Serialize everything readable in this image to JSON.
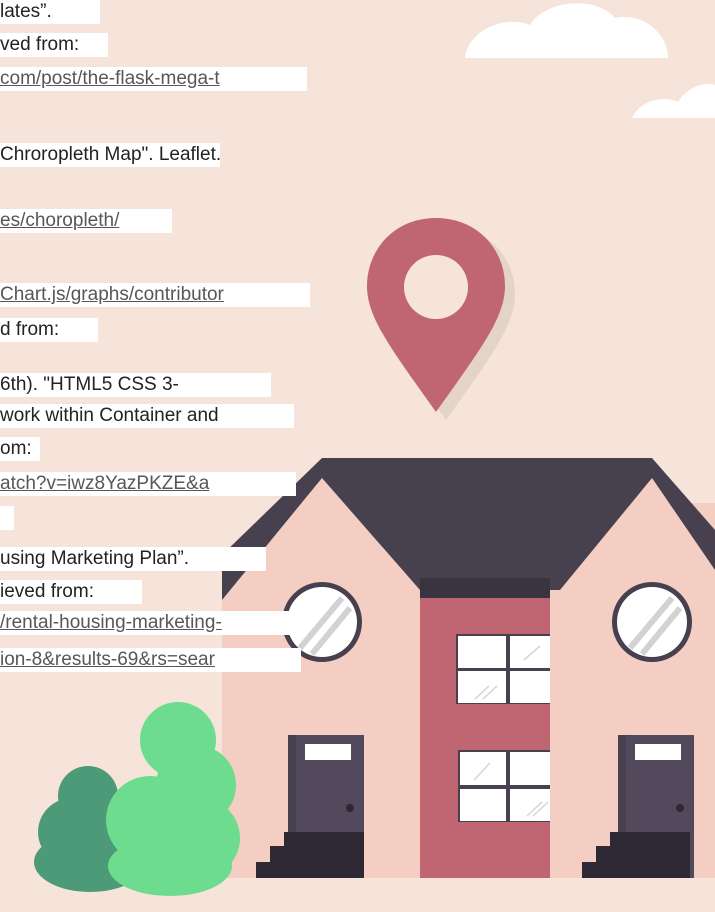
{
  "references": [
    {
      "text": "lates”.",
      "link": false
    },
    {
      "text": "ved from:",
      "link": false
    },
    {
      "text": "com/post/the-flask-mega-t",
      "link": true
    },
    {
      "text": "Chroropleth Map\". Leaflet.",
      "link": false
    },
    {
      "text": "es/choropleth/",
      "link": true
    },
    {
      "text": "Chart.js/graphs/contributor",
      "link": true
    },
    {
      "text": "d from:",
      "link": false
    },
    {
      "text": "6th). \"HTML5 CSS 3-",
      "link": false
    },
    {
      "text": "work within Container and",
      "link": false
    },
    {
      "text": "om:",
      "link": false
    },
    {
      "text": "atch?v=iwz8YazPKZE&a",
      "link": true
    },
    {
      "text": "",
      "link": true
    },
    {
      "text": "using Marketing Plan”.",
      "link": false
    },
    {
      "text": "ieved from:",
      "link": false
    },
    {
      "text": "/rental-housing-marketing-",
      "link": true
    },
    {
      "text": "ion-8&results-69&rs=sear",
      "link": true
    }
  ],
  "colors": {
    "background": "#f6e4da",
    "roof": "#46404f",
    "wall": "#f4cdc3",
    "pin": "#c06672",
    "door": "#46404f",
    "center_door": "#c06672",
    "bush_dark": "#4d9a79",
    "bush_light": "#6ddc8e",
    "cloud": "#ffffff",
    "link_text": "#575757"
  },
  "icons": [
    "location-pin-icon",
    "cloud-icon",
    "house-illustration",
    "bush-illustration"
  ]
}
